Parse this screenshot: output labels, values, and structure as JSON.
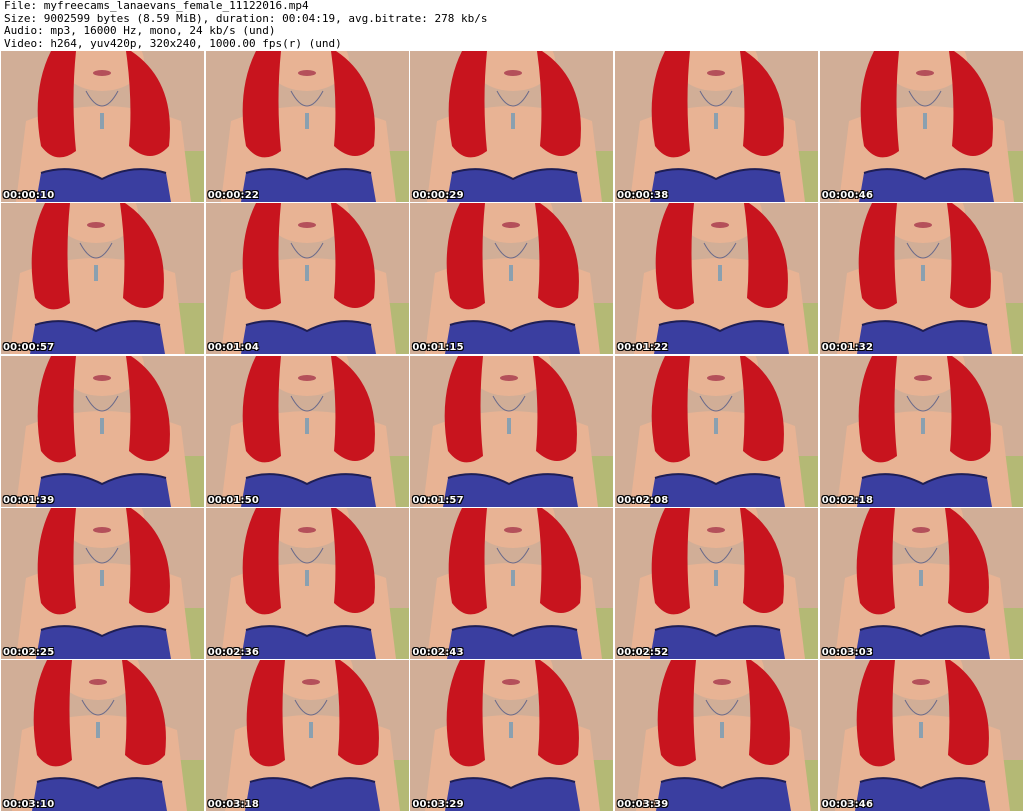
{
  "header": {
    "file_line": "File: myfreecams_lanaevans_female_11122016.mp4",
    "size_line": "Size: 9002599 bytes (8.59 MiB), duration: 00:04:19, avg.bitrate: 278 kb/s",
    "audio_line": "Audio: mp3, 16000 Hz, mono, 24 kb/s (und)",
    "video_line": "Video: h264, yuv420p, 320x240, 1000.00 fps(r) (und)"
  },
  "colors": {
    "background": "#ffffff",
    "hair": "#c8141e",
    "bustier": "#3a3ea0",
    "skin": "#e8b394",
    "backdrop": "#c9a48c"
  },
  "thumbnails": [
    {
      "timestamp": "00:00:10"
    },
    {
      "timestamp": "00:00:22"
    },
    {
      "timestamp": "00:00:29"
    },
    {
      "timestamp": "00:00:38"
    },
    {
      "timestamp": "00:00:46"
    },
    {
      "timestamp": "00:00:57"
    },
    {
      "timestamp": "00:01:04"
    },
    {
      "timestamp": "00:01:15"
    },
    {
      "timestamp": "00:01:22"
    },
    {
      "timestamp": "00:01:32"
    },
    {
      "timestamp": "00:01:39"
    },
    {
      "timestamp": "00:01:50"
    },
    {
      "timestamp": "00:01:57"
    },
    {
      "timestamp": "00:02:08"
    },
    {
      "timestamp": "00:02:18"
    },
    {
      "timestamp": "00:02:25"
    },
    {
      "timestamp": "00:02:36"
    },
    {
      "timestamp": "00:02:43"
    },
    {
      "timestamp": "00:02:52"
    },
    {
      "timestamp": "00:03:03"
    },
    {
      "timestamp": "00:03:10"
    },
    {
      "timestamp": "00:03:18"
    },
    {
      "timestamp": "00:03:29"
    },
    {
      "timestamp": "00:03:39"
    },
    {
      "timestamp": "00:03:46"
    }
  ]
}
